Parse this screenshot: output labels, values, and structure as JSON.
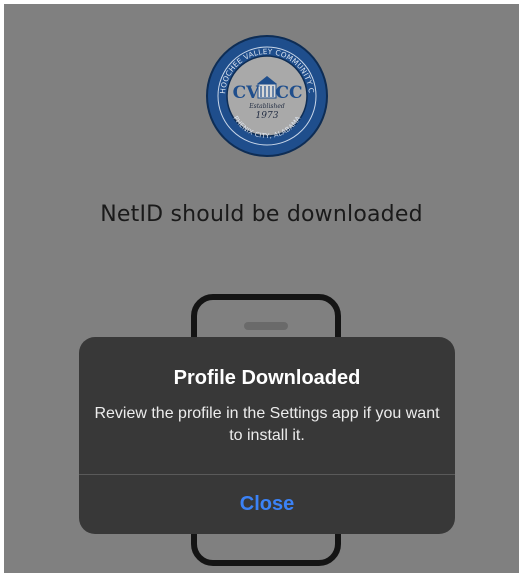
{
  "seal": {
    "outer_text": "CHATTAHOOCHEE VALLEY COMMUNITY COLLEGE",
    "bottom_text": "PHENIX CITY, ALABAMA",
    "left_letters": "CV",
    "right_letters": "CC",
    "established_label": "Established",
    "year": "1973"
  },
  "headline": "NetID should be downloaded",
  "alert": {
    "title": "Profile Downloaded",
    "message": "Review the profile in the Settings app if you want to install it.",
    "close_label": "Close"
  },
  "colors": {
    "dim_overlay": "#808080",
    "alert_bg": "#383838",
    "accent": "#3b82f6",
    "seal_blue": "#1f4e8c"
  }
}
